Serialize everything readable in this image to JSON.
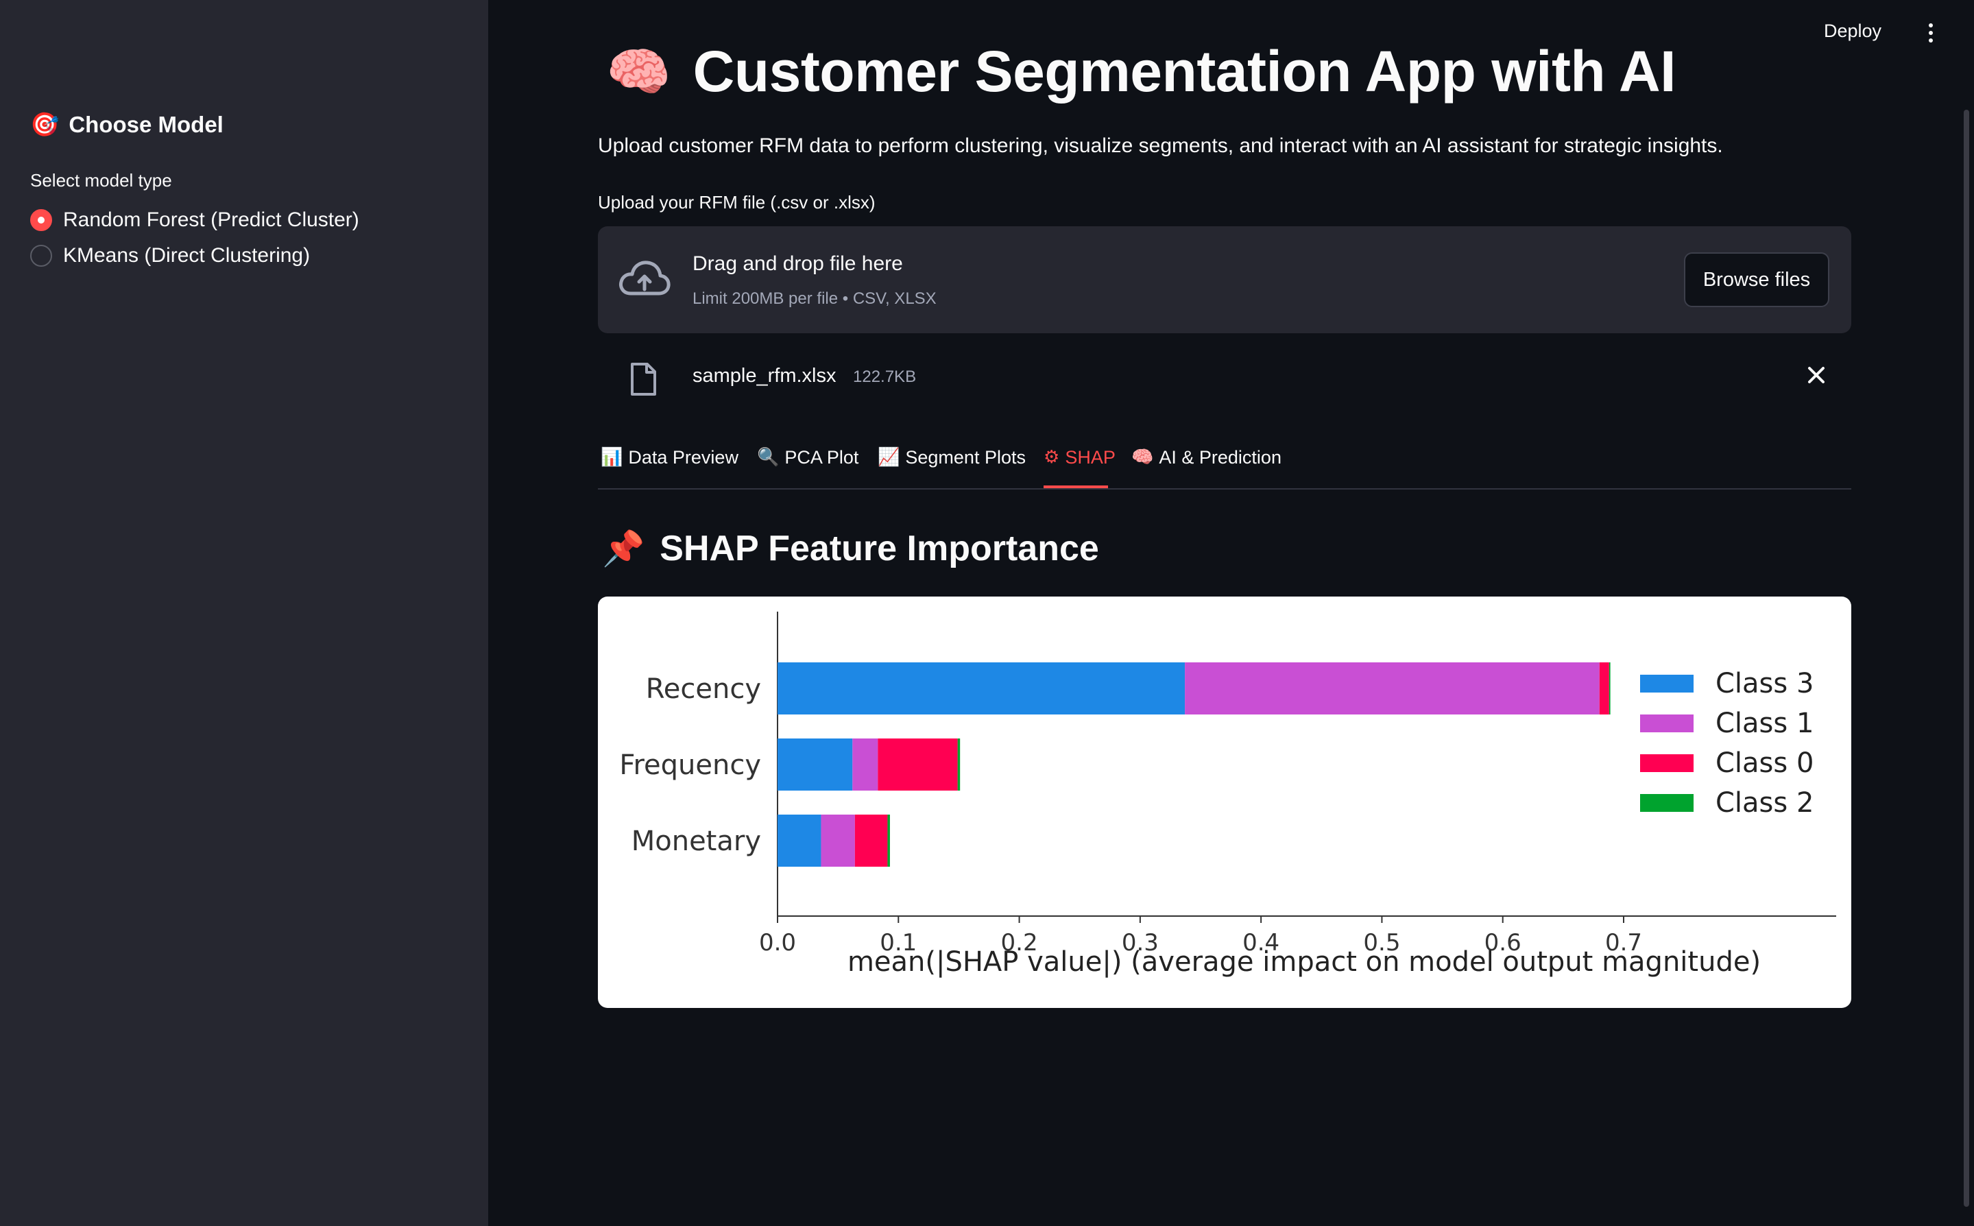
{
  "sidebar": {
    "header_emoji": "🎯",
    "header": "Choose Model",
    "radio_label": "Select model type",
    "options": [
      {
        "label": "Random Forest (Predict Cluster)",
        "selected": true
      },
      {
        "label": "KMeans (Direct Clustering)",
        "selected": false
      }
    ]
  },
  "topbar": {
    "deploy": "Deploy",
    "menu_icon": "kebab-menu-icon"
  },
  "header": {
    "emoji": "🧠",
    "title": "Customer Segmentation App with AI",
    "intro": "Upload customer RFM data to perform clustering, visualize segments, and interact with an AI assistant for strategic insights."
  },
  "uploader": {
    "label": "Upload your RFM file (.csv or .xlsx)",
    "drag_text": "Drag and drop file here",
    "limit_text": "Limit 200MB per file • CSV, XLSX",
    "browse_label": "Browse files",
    "icon": "cloud-upload-icon",
    "file": {
      "name": "sample_rfm.xlsx",
      "size": "122.7KB",
      "icon": "file-icon"
    }
  },
  "tabs": [
    {
      "icon": "📊",
      "label": "Data Preview",
      "active": false
    },
    {
      "icon": "🔍",
      "label": "PCA Plot",
      "active": false
    },
    {
      "icon": "📈",
      "label": "Segment Plots",
      "active": false
    },
    {
      "icon": "⚙",
      "label": "SHAP",
      "active": true
    },
    {
      "icon": "🧠",
      "label": "AI & Prediction",
      "active": false
    }
  ],
  "section": {
    "emoji": "📌",
    "title": "SHAP Feature Importance"
  },
  "colors": {
    "accent": "#ff4b4b",
    "background": "#0e1117",
    "sidebar": "#262730"
  },
  "chart_data": {
    "type": "bar",
    "orientation": "horizontal",
    "stacked": true,
    "categories": [
      "Recency",
      "Frequency",
      "Monetary"
    ],
    "series": [
      {
        "name": "Class 3",
        "color": "#1e88e5",
        "values": [
          0.337,
          0.062,
          0.036
        ]
      },
      {
        "name": "Class 1",
        "color": "#c94fd4",
        "values": [
          0.343,
          0.021,
          0.028
        ]
      },
      {
        "name": "Class 0",
        "color": "#ff0052",
        "values": [
          0.008,
          0.066,
          0.027
        ]
      },
      {
        "name": "Class 2",
        "color": "#00a32e",
        "values": [
          0.001,
          0.002,
          0.002
        ]
      }
    ],
    "xlabel": "mean(|SHAP value|) (average impact on model output magnitude)",
    "ylabel": "",
    "xlim": [
      0,
      0.72
    ],
    "xticks": [
      "0.0",
      "0.1",
      "0.2",
      "0.3",
      "0.4",
      "0.5",
      "0.6",
      "0.7"
    ],
    "legend_position": "right",
    "grid": false
  }
}
